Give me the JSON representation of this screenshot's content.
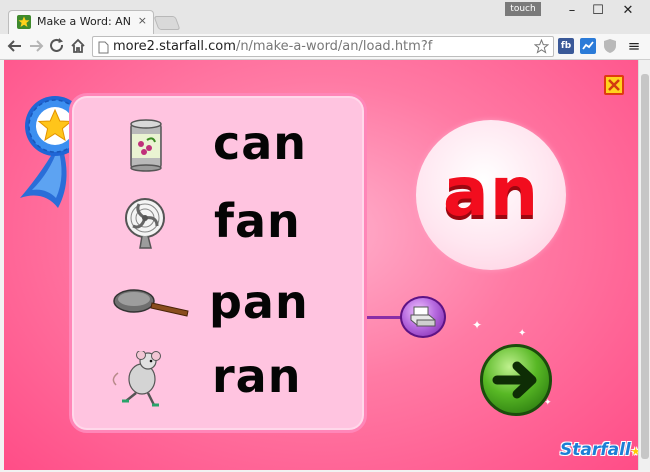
{
  "browser": {
    "tab_title": "Make a Word: AN",
    "tab_close": "×",
    "touch_label": "touch",
    "url_host": "more2.starfall.com",
    "url_path": "/n/make-a-word/an/load.htm?f",
    "ext_fb": "fb",
    "minimize": "–",
    "maximize": "☐",
    "close": "✕",
    "menu": "≡"
  },
  "game": {
    "word_family": "an",
    "words": [
      {
        "text": "can",
        "picture": "can-icon"
      },
      {
        "text": "fan",
        "picture": "fan-icon"
      },
      {
        "text": "pan",
        "picture": "pan-icon"
      },
      {
        "text": "ran",
        "picture": "mouse-running-icon"
      }
    ],
    "logo_text": "Starfall",
    "icons": {
      "reward": "award-ribbon-icon",
      "close": "close-icon",
      "print": "printer-icon",
      "next": "arrow-right-icon"
    }
  }
}
